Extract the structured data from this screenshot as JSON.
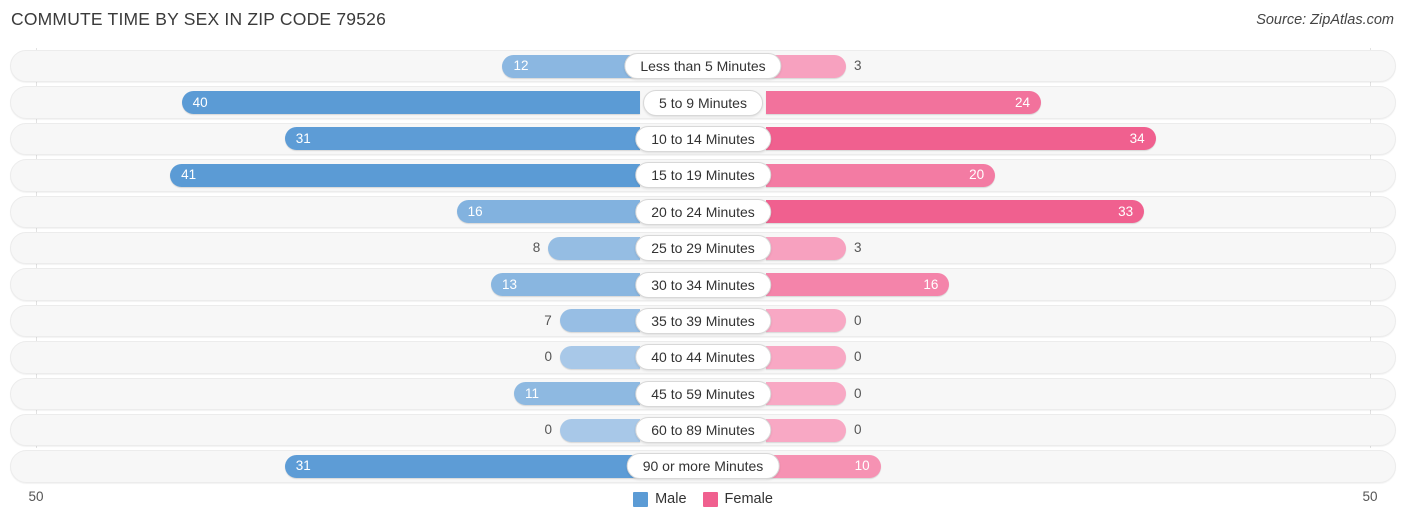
{
  "header": {
    "title": "COMMUTE TIME BY SEX IN ZIP CODE 79526",
    "source": "Source: ZipAtlas.com"
  },
  "axis": {
    "left_label": "50",
    "right_label": "50",
    "max": 50
  },
  "legend": {
    "items": [
      {
        "label": "Male",
        "color": "#5b9bd5"
      },
      {
        "label": "Female",
        "color": "#f0608f"
      }
    ]
  },
  "colors": {
    "male": "#5b9bd5",
    "male_light": "#a8c8e8",
    "female": "#f0608f",
    "female_light": "#f8a8c4",
    "track": "#f7f7f7",
    "gridline": "#e2e2e2"
  },
  "chart_data": {
    "type": "bar",
    "title": "COMMUTE TIME BY SEX IN ZIP CODE 79526",
    "subtitle": "",
    "xlabel": "",
    "ylabel": "",
    "orientation": "horizontal-diverging",
    "grid": true,
    "legend_position": "bottom-center",
    "xlim": [
      50,
      50
    ],
    "categories": [
      "Less than 5 Minutes",
      "5 to 9 Minutes",
      "10 to 14 Minutes",
      "15 to 19 Minutes",
      "20 to 24 Minutes",
      "25 to 29 Minutes",
      "30 to 34 Minutes",
      "35 to 39 Minutes",
      "40 to 44 Minutes",
      "45 to 59 Minutes",
      "60 to 89 Minutes",
      "90 or more Minutes"
    ],
    "series": [
      {
        "name": "Male",
        "color": "#5b9bd5",
        "side": "left",
        "values": [
          12,
          40,
          31,
          41,
          16,
          8,
          13,
          7,
          0,
          11,
          0,
          31
        ]
      },
      {
        "name": "Female",
        "color": "#f0608f",
        "side": "right",
        "values": [
          3,
          24,
          34,
          20,
          33,
          3,
          16,
          0,
          0,
          0,
          0,
          10
        ]
      }
    ]
  }
}
